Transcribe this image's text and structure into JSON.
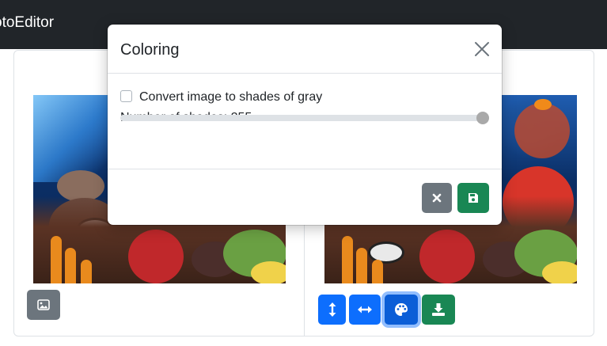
{
  "navbar": {
    "brand": "otoEditor"
  },
  "panels": {
    "left": {
      "image_icon": "image-icon"
    },
    "right": {
      "buttons": [
        "vertical-arrows-icon",
        "horizontal-arrows-icon",
        "palette-icon",
        "download-icon"
      ]
    }
  },
  "modal": {
    "title": "Coloring",
    "checkbox_label": "Convert image to shades of gray",
    "checkbox_checked": false,
    "shades_label": "Number of shades: 255",
    "slider_value": 255,
    "slider_max": 255,
    "footer": {
      "cancel_icon": "close-icon",
      "save_icon": "save-icon"
    }
  },
  "colors": {
    "navbar": "#212529",
    "primary": "#0d6efd",
    "success": "#198754",
    "secondary": "#6c757d",
    "slider_track": "#dee2e6",
    "slider_thumb": "#a9a9a9"
  }
}
